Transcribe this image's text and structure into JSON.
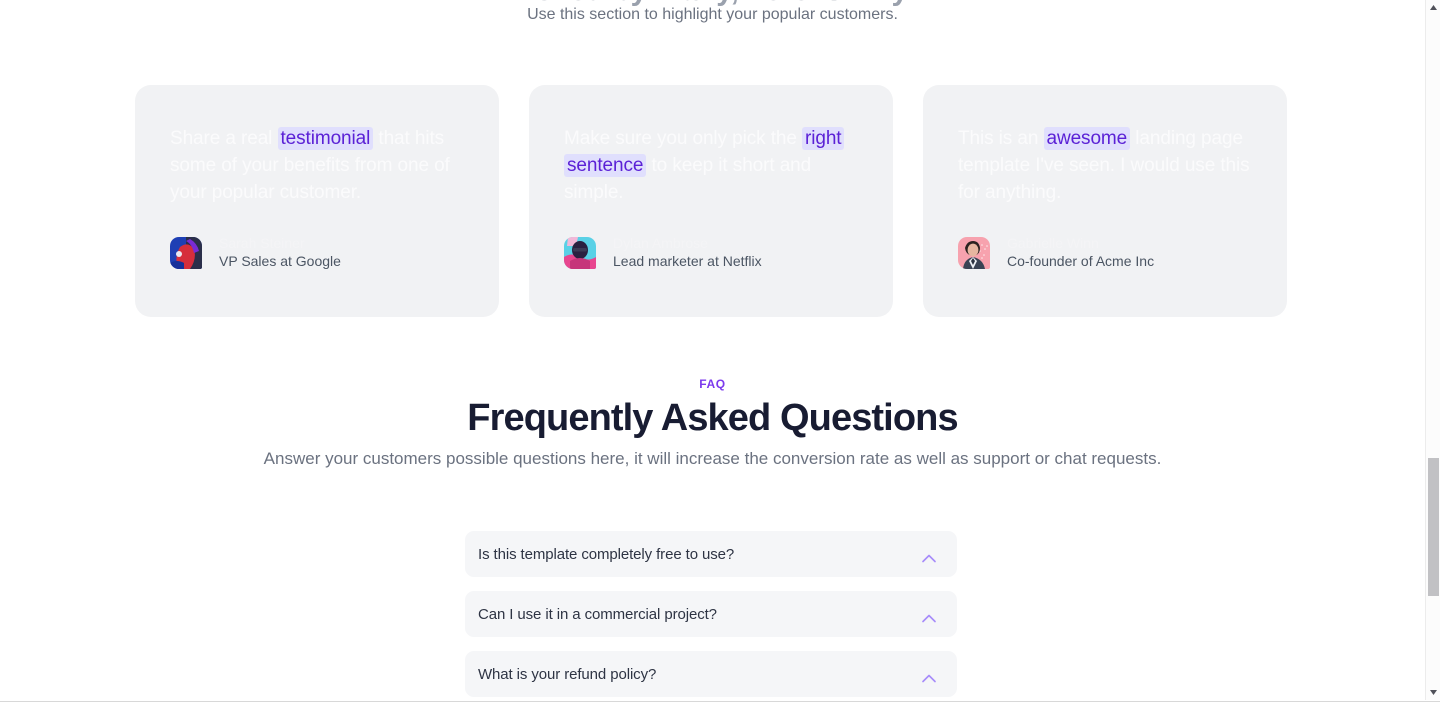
{
  "section": {
    "clipped_heading": "Loved by many, here is why",
    "subtitle": "Use this section to highlight your popular customers."
  },
  "testimonials": [
    {
      "quote_before": "Share a real ",
      "highlight": "testimonial",
      "quote_after": " that hits some of your benefits from one of your popular customer.",
      "name": "Sarah Steiner",
      "role": "VP Sales at Google",
      "avatar_name": "avatar-sarah-steiner",
      "avatar_colors": [
        "#1e3fb4",
        "#d62e3c",
        "#2b2f4a",
        "#7a2bd6"
      ]
    },
    {
      "quote_before": "Make sure you only pick the ",
      "highlight": "right sentence",
      "quote_after": " to keep it short and simple.",
      "name": "Dylan Ambrose",
      "role": "Lead marketer at Netflix",
      "avatar_name": "avatar-dylan-ambrose",
      "avatar_colors": [
        "#5ad1e6",
        "#e8468f",
        "#2a2040",
        "#f2b8d8"
      ]
    },
    {
      "quote_before": "This is an ",
      "highlight": "awesome",
      "quote_after": " landing page template I've seen. I would use this for anything.",
      "name": "Gabrielle Winn",
      "role": "Co-founder of Acme Inc",
      "avatar_name": "avatar-gabrielle-winn",
      "avatar_colors": [
        "#f7a2ae",
        "#3a4354",
        "#e6b6a0",
        "#2b3240"
      ]
    }
  ],
  "faq": {
    "eyebrow": "FAQ",
    "title": "Frequently Asked Questions",
    "description": "Answer your customers possible questions here, it will increase the conversion rate as well as support or chat requests.",
    "items": [
      {
        "question": "Is this template completely free to use?",
        "icon": "chevron-up-icon"
      },
      {
        "question": "Can I use it in a commercial project?",
        "icon": "chevron-up-icon"
      },
      {
        "question": "What is your refund policy?",
        "icon": "chevron-up-icon"
      }
    ]
  },
  "colors": {
    "accent_purple": "#7c3aed",
    "highlight_bg": "#e0dffd",
    "highlight_text": "#5b21d6",
    "card_bg": "#f1f2f4",
    "faq_item_bg": "#f5f6f8",
    "heading": "#181c32",
    "body_text": "#6b7280",
    "scrollbar_thumb": "#c1c1c4"
  },
  "scrollbar": {
    "vertical_name": "vertical-scrollbar",
    "horizontal_name": "horizontal-scrollbar"
  }
}
